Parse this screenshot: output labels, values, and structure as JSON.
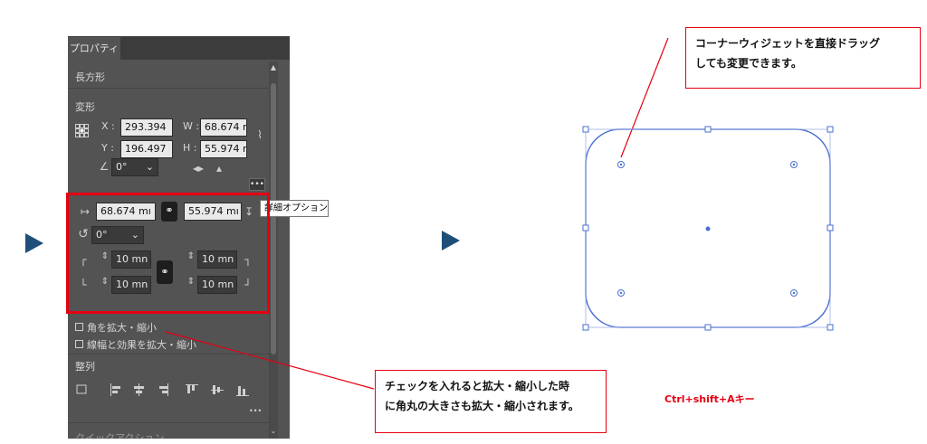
{
  "panel": {
    "tab_label": "プロパティ",
    "section_shape": "長方形",
    "section_transform": "変形",
    "x_label": "X :",
    "x_value": "293.394",
    "y_label": "Y :",
    "y_value": "196.497",
    "w_label": "W :",
    "w_value": "68.674 r",
    "h_label": "H :",
    "h_value": "55.974 r",
    "angle_value": "0°",
    "more_label": "•••",
    "detail_width": "68.674 mı",
    "detail_height": "55.974 mı",
    "detail_rotate": "0°",
    "corner_tl": "10 mn",
    "corner_tr": "10 mn",
    "corner_bl": "10 mn",
    "corner_br": "10 mn",
    "scale_corners_label": "角を拡大・縮小",
    "scale_strokes_label": "線幅と効果を拡大・縮小",
    "section_align": "整列",
    "align_more_label": "•••",
    "bottom_label": "クイックアクション"
  },
  "tooltip": "詳細オプション",
  "callout_top": {
    "line1": "コーナーウィジェットを直接ドラッグ",
    "line2": "しても変更できます。"
  },
  "callout_bottom": {
    "line1": "チェックを入れると拡大・縮小した時",
    "line2": "に角丸の大きさも拡大・縮小されます。"
  },
  "shortcut_text": "Ctrl+shift+Aキー",
  "colors": {
    "accent_red": "#e60012",
    "shape_blue": "#4a6fd1",
    "arrow_navy": "#1f4e79",
    "panel_bg": "#535353"
  }
}
